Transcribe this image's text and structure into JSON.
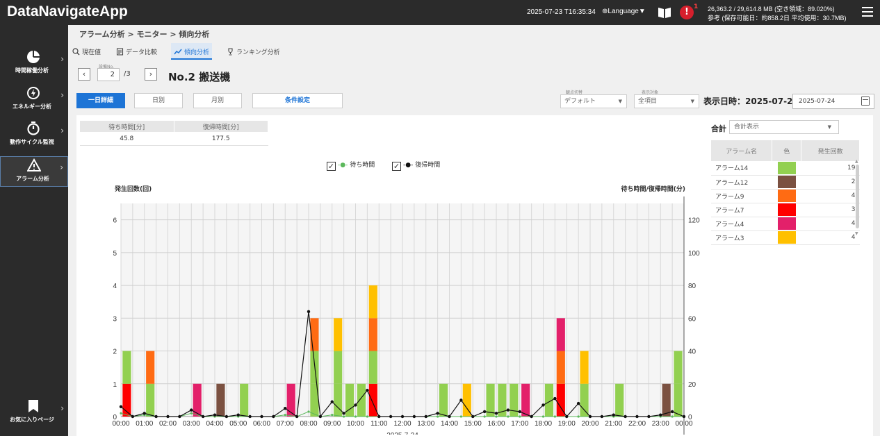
{
  "app": {
    "title": "DataNavigateApp"
  },
  "header": {
    "datetime": "2025-07-23 T16:35:34",
    "language": "⊕Language▼",
    "alert_count": "1",
    "storage_line1": "26,363.2 / 29,614.8 MB (空き領域：89.020%)",
    "storage_line2": "参考 (保存可能日：約858.2日 平均使用：30.7MB)"
  },
  "sidebar": {
    "items": [
      {
        "label": "時間稼働分析",
        "icon": "pie-chart-icon"
      },
      {
        "label": "エネルギー分析",
        "icon": "energy-icon"
      },
      {
        "label": "動作サイクル監視",
        "icon": "stopwatch-icon"
      },
      {
        "label": "アラーム分析",
        "icon": "warning-icon"
      }
    ],
    "favorites": {
      "label": "お気に入りページ",
      "icon": "bookmark-icon"
    }
  },
  "breadcrumb": "アラーム分析 > モニター > 傾向分析",
  "tabs": [
    {
      "label": "現在値"
    },
    {
      "label": "データ比較"
    },
    {
      "label": "傾向分析"
    },
    {
      "label": "ランキング分析"
    }
  ],
  "unit": {
    "label": "設備No.",
    "value": "2",
    "total": "/3",
    "name": "No.2 搬送機"
  },
  "controls": {
    "daily_detail": "一日詳細",
    "daily": "日別",
    "monthly": "月別",
    "condition": "条件設定",
    "view_switch_label": "観点切替",
    "view_switch_value": "デフォルト",
    "display_target_label": "表示対象",
    "display_target_value": "全項目",
    "display_date_label": "表示日時：2025-07-24~",
    "date_value": "2025-07-24"
  },
  "summary": {
    "headers": [
      "待ち時間[分]",
      "復帰時間[分]"
    ],
    "values": [
      "45.8",
      "177.5"
    ]
  },
  "legend": {
    "wait": "待ち時間",
    "recovery": "復帰時間"
  },
  "right_panel": {
    "total_label": "合計",
    "total_select": "合計表示",
    "headers": [
      "アラーム名",
      "色",
      "発生回数"
    ],
    "rows": [
      {
        "name": "アラーム14",
        "color": "#92d050",
        "count": "19"
      },
      {
        "name": "アラーム12",
        "color": "#7b5141",
        "count": "2"
      },
      {
        "name": "アラーム9",
        "color": "#ff6b13",
        "count": "4"
      },
      {
        "name": "アラーム7",
        "color": "#ff0000",
        "count": "3"
      },
      {
        "name": "アラーム4",
        "color": "#e3206a",
        "count": "4"
      },
      {
        "name": "アラーム3",
        "color": "#ffc000",
        "count": "4"
      }
    ]
  },
  "chart_data": {
    "type": "bar",
    "title": "",
    "ylabel": "発生回数(回)",
    "y2label": "待ち時間/復帰時間(分)",
    "xlabel": "2025-7-24",
    "ylim": [
      0,
      6.5
    ],
    "y2lim": [
      0,
      130
    ],
    "yticks": [
      1,
      2,
      3,
      4,
      5,
      6
    ],
    "y2ticks": [
      0,
      20,
      40,
      60,
      80,
      100,
      120
    ],
    "xtick_labels": [
      "00:00",
      "01:00",
      "02:00",
      "03:00",
      "04:00",
      "05:00",
      "06:00",
      "07:00",
      "08:00",
      "09:00",
      "10:00",
      "11:00",
      "12:00",
      "13:00",
      "14:00",
      "15:00",
      "16:00",
      "17:00",
      "18:00",
      "19:00",
      "20:00",
      "21:00",
      "22:00",
      "23:00",
      "00:00"
    ],
    "bar_slot_minutes": 30,
    "alarm_colors": {
      "アラーム14": "#92d050",
      "アラーム12": "#7b5141",
      "アラーム9": "#ff6b13",
      "アラーム7": "#ff0000",
      "アラーム4": "#e3206a",
      "アラーム3": "#ffc000"
    },
    "bars": [
      {
        "slot": 0,
        "stack": [
          "アラーム7",
          "アラーム14"
        ]
      },
      {
        "slot": 2,
        "stack": [
          "アラーム14",
          "アラーム9"
        ]
      },
      {
        "slot": 6,
        "stack": [
          "アラーム4"
        ]
      },
      {
        "slot": 8,
        "stack": [
          "アラーム12"
        ]
      },
      {
        "slot": 10,
        "stack": [
          "アラーム14"
        ]
      },
      {
        "slot": 14,
        "stack": [
          "アラーム4"
        ]
      },
      {
        "slot": 16,
        "stack": [
          "アラーム14",
          "アラーム14",
          "アラーム9"
        ]
      },
      {
        "slot": 18,
        "stack": [
          "アラーム14",
          "アラーム14",
          "アラーム3"
        ]
      },
      {
        "slot": 19,
        "stack": [
          "アラーム14"
        ]
      },
      {
        "slot": 20,
        "stack": [
          "アラーム14"
        ]
      },
      {
        "slot": 21,
        "stack": [
          "アラーム7",
          "アラーム14",
          "アラーム9",
          "アラーム3"
        ]
      },
      {
        "slot": 27,
        "stack": [
          "アラーム14"
        ]
      },
      {
        "slot": 29,
        "stack": [
          "アラーム3"
        ]
      },
      {
        "slot": 31,
        "stack": [
          "アラーム14"
        ]
      },
      {
        "slot": 32,
        "stack": [
          "アラーム14"
        ]
      },
      {
        "slot": 33,
        "stack": [
          "アラーム14"
        ]
      },
      {
        "slot": 34,
        "stack": [
          "アラーム4"
        ]
      },
      {
        "slot": 36,
        "stack": [
          "アラーム14"
        ]
      },
      {
        "slot": 37,
        "stack": [
          "アラーム7",
          "アラーム9",
          "アラーム4"
        ]
      },
      {
        "slot": 39,
        "stack": [
          "アラーム14",
          "アラーム3"
        ]
      },
      {
        "slot": 42,
        "stack": [
          "アラーム14"
        ]
      },
      {
        "slot": 46,
        "stack": [
          "アラーム12"
        ]
      },
      {
        "slot": 47,
        "stack": [
          "アラーム14",
          "アラーム14"
        ]
      }
    ],
    "series": [
      {
        "name": "待ち時間",
        "color": "#5cb85c",
        "values": [
          2,
          0,
          1,
          0,
          0,
          0,
          2,
          0,
          0,
          0,
          0,
          0,
          0,
          0,
          1,
          0,
          3,
          0,
          1,
          0,
          0,
          0,
          0,
          0,
          0,
          0,
          0,
          0,
          0,
          0,
          0,
          0,
          0,
          0,
          0,
          0,
          0,
          0,
          0,
          0,
          0,
          0,
          0,
          0,
          0,
          0,
          0,
          0,
          0
        ]
      },
      {
        "name": "復帰時間",
        "color": "#111111",
        "values": [
          6,
          0,
          2,
          0,
          0,
          0,
          4,
          0,
          1,
          0,
          1,
          0,
          0,
          0,
          5,
          0,
          64,
          0,
          9,
          2,
          7,
          16,
          0,
          0,
          0,
          0,
          0,
          2,
          0,
          10,
          0,
          3,
          2,
          4,
          3,
          0,
          7,
          11,
          0,
          8,
          0,
          0,
          1,
          0,
          0,
          0,
          1,
          3,
          0
        ]
      }
    ]
  }
}
